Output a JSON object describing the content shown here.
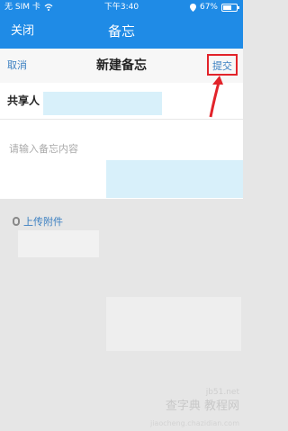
{
  "status_bar": {
    "carrier": "无 SIM 卡",
    "time": "下午3:40",
    "battery_percent": "67%"
  },
  "nav": {
    "close_label": "关闭",
    "title": "备忘"
  },
  "sheet": {
    "cancel_label": "取消",
    "title": "新建备忘",
    "submit_label": "提交"
  },
  "share": {
    "label": "共享人"
  },
  "memo": {
    "placeholder": "请输入备忘内容"
  },
  "attachment": {
    "label": "上传附件"
  },
  "watermark": {
    "text": "查字典 教程网",
    "site": "jb51.net",
    "url": "jiaocheng.chazidian.com"
  },
  "colors": {
    "nav_blue": "#1f8be6",
    "link_blue": "#3a7fc1",
    "highlight_red": "#e2232a"
  }
}
